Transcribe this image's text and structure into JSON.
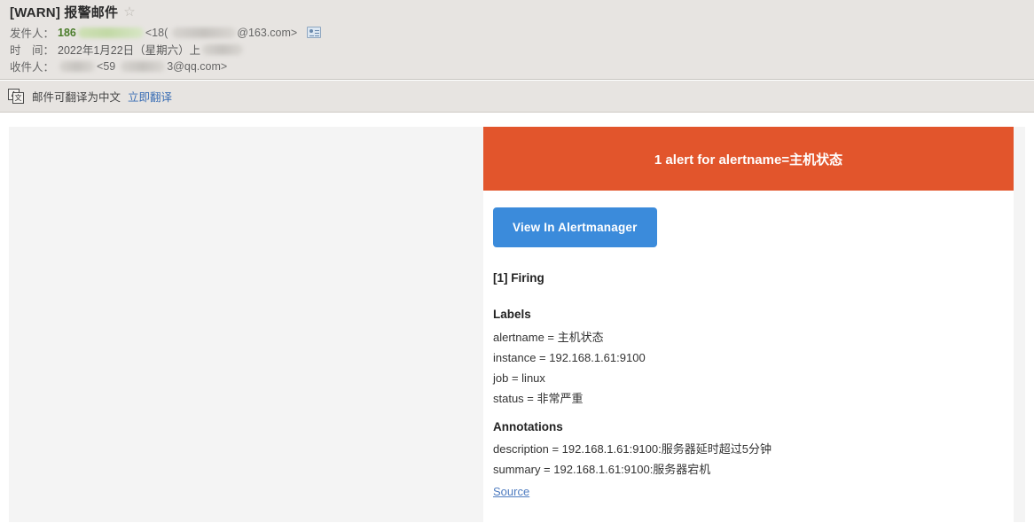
{
  "mail": {
    "subject": "[WARN] 报警邮件",
    "star_icon": "star-outline-icon",
    "sender_label": "发件人：",
    "sender_name_visible": "186",
    "sender_email_prefix": "<18(",
    "sender_email_suffix": "@163.com>",
    "contact_icon": "contact-card-icon",
    "date_label": "时　间：",
    "date_value": "2022年1月22日（星期六）上",
    "recipient_label": "收件人：",
    "recipient_email_prefix": "<59",
    "recipient_email_suffix": "3@qq.com>"
  },
  "translate_bar": {
    "icon": "translate-icon",
    "icon_glyph_left": "A",
    "icon_glyph_right": "文",
    "text": "邮件可翻译为中文",
    "link": "立即翻译"
  },
  "alert": {
    "banner_text": "1 alert for alertname=主机状态",
    "banner_color": "#e2552c",
    "button_label": "View In Alertmanager",
    "button_color": "#3b8bdb",
    "firing_title": "[1] Firing",
    "labels_heading": "Labels",
    "labels": [
      "alertname = 主机状态",
      "instance = 192.168.1.61:9100",
      "job = linux",
      "status = 非常严重"
    ],
    "annotations_heading": "Annotations",
    "annotations": [
      "description = 192.168.1.61:9100:服务器延时超过5分钟",
      "summary = 192.168.1.61:9100:服务器宕机"
    ],
    "source_link": "Source",
    "source_link_color": "#4f7cc0"
  }
}
